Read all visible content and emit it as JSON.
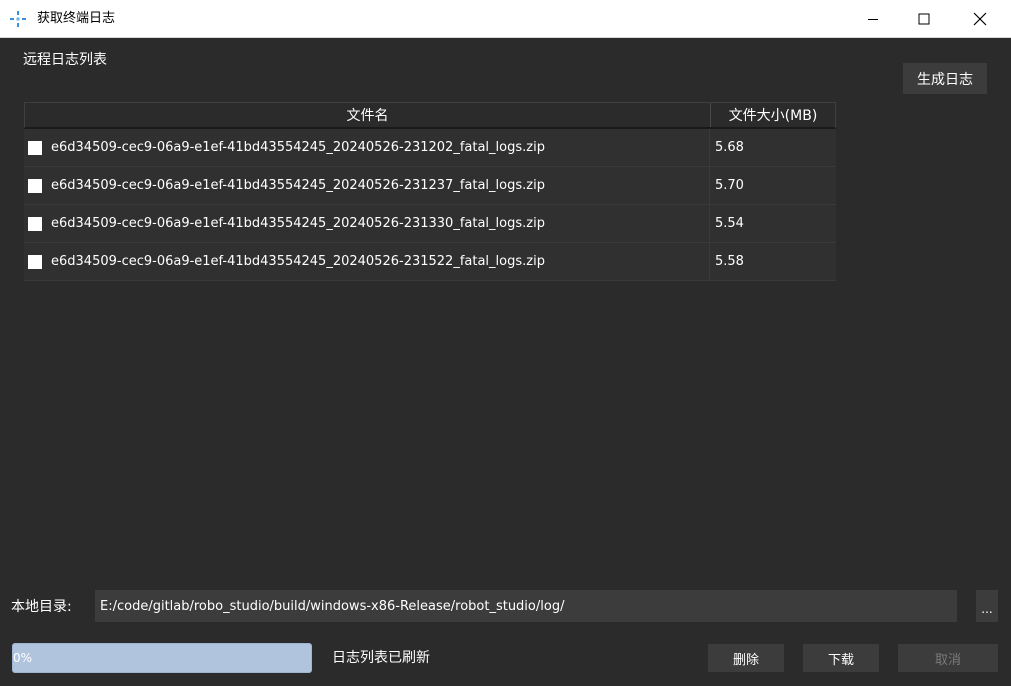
{
  "window": {
    "title": "获取终端日志",
    "icon": "crosshair-app-icon",
    "controls": [
      "minimize-icon",
      "maximize-icon",
      "close-icon"
    ]
  },
  "remote_panel": {
    "label": "远程日志列表",
    "generate_button": "生成日志"
  },
  "table": {
    "columns": [
      "文件名",
      "文件大小(MB)"
    ],
    "rows": [
      {
        "checked": false,
        "name": "e6d34509-cec9-06a9-e1ef-41bd43554245_20240526-231202_fatal_logs.zip",
        "size": "5.68"
      },
      {
        "checked": false,
        "name": "e6d34509-cec9-06a9-e1ef-41bd43554245_20240526-231237_fatal_logs.zip",
        "size": "5.70"
      },
      {
        "checked": false,
        "name": "e6d34509-cec9-06a9-e1ef-41bd43554245_20240526-231330_fatal_logs.zip",
        "size": "5.54"
      },
      {
        "checked": false,
        "name": "e6d34509-cec9-06a9-e1ef-41bd43554245_20240526-231522_fatal_logs.zip",
        "size": "5.58"
      }
    ]
  },
  "local_dir": {
    "label": "本地目录:",
    "path": "E:/code/gitlab/robo_studio/build/windows-x86-Release/robot_studio/log/",
    "browse_button": "..."
  },
  "progress": {
    "value": 0,
    "text": "0%"
  },
  "status": {
    "text": "日志列表已刷新"
  },
  "actions": {
    "delete": "删除",
    "download": "下载",
    "cancel": "取消"
  },
  "colors": {
    "background": "#2b2b2b",
    "row": "#303030",
    "button": "#3c3c3c",
    "progress_bar": "#b0c4de",
    "disabled_text": "#7a7a7a"
  }
}
